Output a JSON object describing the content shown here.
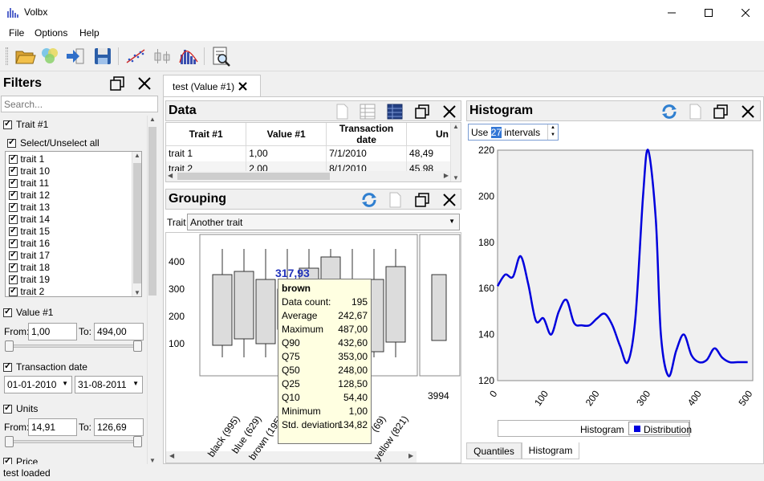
{
  "window": {
    "title": "Volbx"
  },
  "menu": [
    "File",
    "Options",
    "Help"
  ],
  "toolbar_icons": [
    "open-folder-icon",
    "filter-icon",
    "import-icon",
    "save-icon",
    "scatter-icon",
    "grouping-icon",
    "histogram-icon",
    "inspect-icon"
  ],
  "filters": {
    "title": "Filters",
    "search_placeholder": "Search...",
    "trait_group": "Trait #1",
    "select_all": "Select/Unselect all",
    "traits": [
      "trait 1",
      "trait 10",
      "trait 11",
      "trait 12",
      "trait 13",
      "trait 14",
      "trait 15",
      "trait 16",
      "trait 17",
      "trait 18",
      "trait 19",
      "trait 2"
    ],
    "value": {
      "label": "Value #1",
      "from_label": "From:",
      "from": "1,00",
      "to_label": "To:",
      "to": "494,00"
    },
    "date": {
      "label": "Transaction date",
      "from": "01-01-2010",
      "to": "31-08-2011"
    },
    "units": {
      "label": "Units",
      "from_label": "From:",
      "from": "14,91",
      "to_label": "To:",
      "to": "126,69"
    },
    "price": {
      "label": "Price"
    }
  },
  "doc_tab": {
    "label": "test (Value #1)"
  },
  "data_panel": {
    "title": "Data",
    "columns": [
      "Trait #1",
      "Value #1",
      "Transaction date",
      "Un"
    ],
    "rows": [
      [
        "trait 1",
        "1,00",
        "7/1/2010",
        "48,49"
      ],
      [
        "trait 2",
        "2,00",
        "8/1/2010",
        "45,98"
      ]
    ]
  },
  "grouping_panel": {
    "title": "Grouping",
    "trait_label": "Trait",
    "trait_value": "Another trait",
    "y_ticks": [
      "400",
      "300",
      "200",
      "100"
    ],
    "x_labels": [
      "black (995)",
      "blue (629)",
      "brown (195)",
      "dark b",
      "(69)",
      "yellow (821)"
    ],
    "overall_label": "3994",
    "highlight_value": "317,93",
    "tooltip": {
      "title": "brown",
      "rows": [
        [
          "Data count:",
          "195"
        ],
        [
          "Average",
          "242,67"
        ],
        [
          "Maximum",
          "487,00"
        ],
        [
          "Q90",
          "432,60"
        ],
        [
          "Q75",
          "353,00"
        ],
        [
          "Q50",
          "248,00"
        ],
        [
          "Q25",
          "128,50"
        ],
        [
          "Q10",
          "54,40"
        ],
        [
          "Minimum",
          "1,00"
        ],
        [
          "Std. deviation",
          "134,82"
        ]
      ]
    }
  },
  "histogram_panel": {
    "title": "Histogram",
    "intervals_prefix": "Use",
    "intervals_value": "27",
    "intervals_suffix": "intervals",
    "legend": [
      "Histogram",
      "Distribution"
    ],
    "tabs": [
      "Quantiles",
      "Histogram"
    ],
    "series_color": "#0000dd"
  },
  "chart_data": {
    "type": "line",
    "series": [
      {
        "name": "Distribution",
        "x": [
          0,
          15,
          30,
          45,
          60,
          75,
          90,
          105,
          120,
          135,
          150,
          165,
          180,
          195,
          210,
          225,
          240,
          255,
          270,
          285,
          295,
          310,
          320,
          335,
          350,
          365,
          380,
          395,
          410,
          425,
          440,
          455,
          470,
          490
        ],
        "y": [
          161,
          166,
          165,
          174,
          162,
          146,
          147,
          140,
          150,
          155,
          145,
          144,
          144,
          147,
          149,
          144,
          135,
          128,
          147,
          200,
          220,
          190,
          140,
          122,
          133,
          140,
          131,
          128,
          129,
          134,
          130,
          128,
          128,
          128
        ]
      }
    ],
    "xlim": [
      0,
      500
    ],
    "ylim": [
      120,
      220
    ],
    "x_ticks": [
      0,
      100,
      200,
      300,
      400,
      500
    ],
    "y_ticks": [
      120,
      140,
      160,
      180,
      200,
      220
    ],
    "legend_placement": "bottom"
  },
  "status": {
    "text": "test loaded"
  }
}
